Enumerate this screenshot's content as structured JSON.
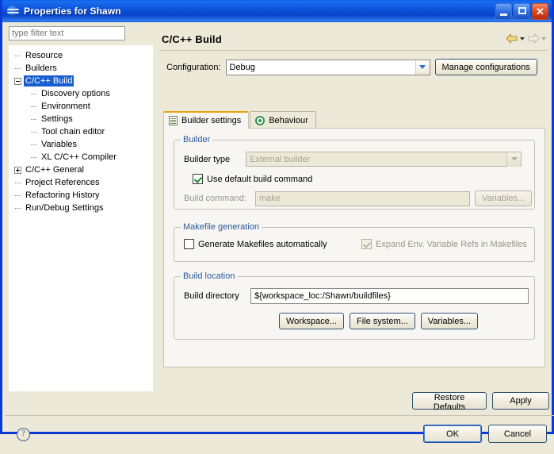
{
  "window": {
    "title": "Properties for Shawn",
    "icon": "eclipse-globe-icon",
    "minimize_label": "",
    "maximize_label": "",
    "close_label": "✕"
  },
  "sidebar": {
    "filter_placeholder": "type filter text",
    "filter_value": "",
    "items": [
      {
        "label": "Resource",
        "level": 1,
        "expander": "none",
        "selected": false
      },
      {
        "label": "Builders",
        "level": 1,
        "expander": "none",
        "selected": false
      },
      {
        "label": "C/C++ Build",
        "level": 1,
        "expander": "minus",
        "selected": true
      },
      {
        "label": "Discovery options",
        "level": 2,
        "expander": "none",
        "selected": false
      },
      {
        "label": "Environment",
        "level": 2,
        "expander": "none",
        "selected": false
      },
      {
        "label": "Settings",
        "level": 2,
        "expander": "none",
        "selected": false
      },
      {
        "label": "Tool chain editor",
        "level": 2,
        "expander": "none",
        "selected": false
      },
      {
        "label": "Variables",
        "level": 2,
        "expander": "none",
        "selected": false
      },
      {
        "label": "XL C/C++ Compiler",
        "level": 2,
        "expander": "none",
        "selected": false
      },
      {
        "label": "C/C++ General",
        "level": 1,
        "expander": "plus",
        "selected": false
      },
      {
        "label": "Project References",
        "level": 1,
        "expander": "none",
        "selected": false
      },
      {
        "label": "Refactoring History",
        "level": 1,
        "expander": "none",
        "selected": false
      },
      {
        "label": "Run/Debug Settings",
        "level": 1,
        "expander": "none",
        "selected": false
      }
    ]
  },
  "page": {
    "title": "C/C++ Build",
    "nav": {
      "back_icon": "back-arrow-icon",
      "forward_icon": "forward-arrow-icon"
    },
    "configuration": {
      "label": "Configuration:",
      "value": "Debug",
      "manage_button": "Manage configurations"
    },
    "tabs": [
      {
        "label": "Builder settings",
        "icon": "list-icon",
        "active": true
      },
      {
        "label": "Behaviour",
        "icon": "target-icon",
        "active": false
      }
    ],
    "builder_group": {
      "legend": "Builder",
      "builder_type_label": "Builder type",
      "builder_type_value": "External builder",
      "use_default_label": "Use default build command",
      "use_default_checked": true,
      "build_command_label": "Build command:",
      "build_command_value": "make",
      "variables_button": "Variables..."
    },
    "makefile_group": {
      "legend": "Makefile generation",
      "generate_label": "Generate Makefiles automatically",
      "generate_checked": false,
      "expand_label": "Expand Env. Variable Refs in Makefiles",
      "expand_checked": true
    },
    "build_location_group": {
      "legend": "Build location",
      "directory_label": "Build directory",
      "directory_value": "${workspace_loc:/Shawn/buildfiles}",
      "workspace_button": "Workspace...",
      "filesystem_button": "File system...",
      "variables_button": "Variables..."
    },
    "restore_defaults_button": "Restore Defaults",
    "apply_button": "Apply"
  },
  "footer": {
    "help_icon": "help-icon",
    "ok_button": "OK",
    "cancel_button": "Cancel"
  }
}
